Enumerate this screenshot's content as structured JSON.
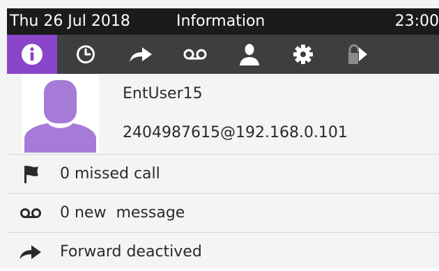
{
  "status_bar": {
    "date": "Thu 26 Jul 2018",
    "title": "Information",
    "time": "23:00"
  },
  "tabs": [
    {
      "icon": "info-icon",
      "active": true
    },
    {
      "icon": "clock-icon",
      "active": false
    },
    {
      "icon": "forward-arrow-icon",
      "active": false
    },
    {
      "icon": "voicemail-icon",
      "active": false
    },
    {
      "icon": "person-icon",
      "active": false
    },
    {
      "icon": "gear-icon",
      "active": false
    },
    {
      "icon": "lock-icon",
      "active": false
    }
  ],
  "user": {
    "name": "EntUser15",
    "address": "2404987615@192.168.0.101"
  },
  "rows": {
    "missed": {
      "icon": "flag-icon",
      "text": "0 missed call"
    },
    "messages": {
      "icon": "voicemail-icon",
      "text": "0 new  message"
    },
    "forward": {
      "icon": "forward-arrow-icon",
      "text": "Forward deactived"
    }
  },
  "colors": {
    "accent": "#8a45cb",
    "status_bar": "#1b1b1b",
    "tab_bar": "#3e3e3e",
    "background": "#f4f4f4"
  }
}
